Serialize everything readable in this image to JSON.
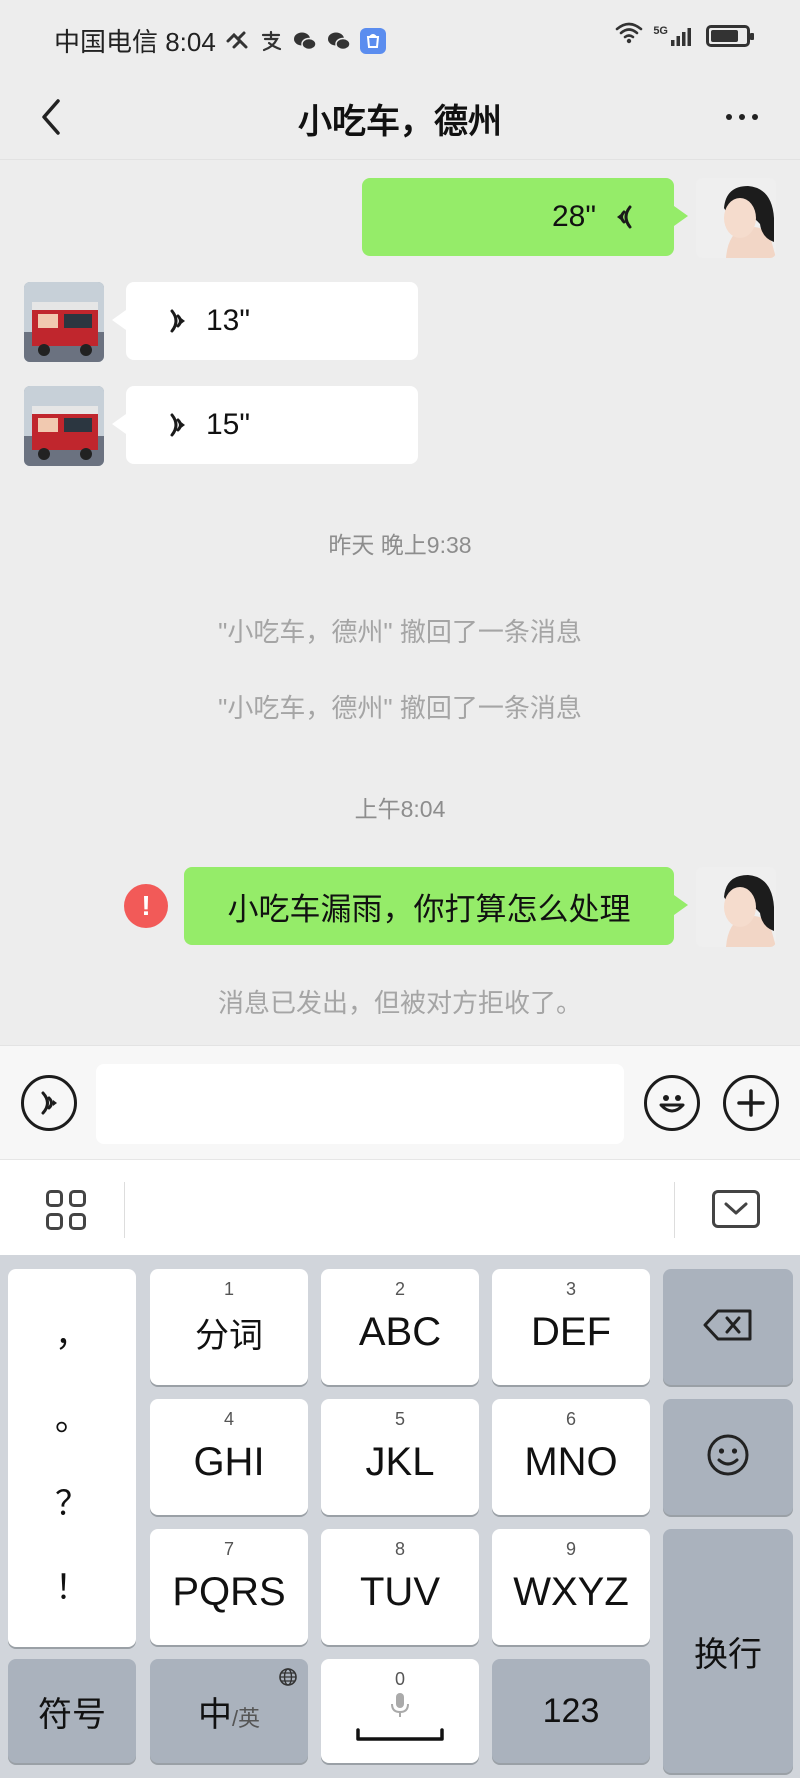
{
  "status_bar": {
    "carrier_time": "中国电信 8:04",
    "icons": [
      "vpn-icon",
      "alipay-icon",
      "wechat-icon",
      "wechat-icon",
      "appstore-icon"
    ],
    "right_icons": [
      "wifi-icon",
      "signal-5g-icon",
      "battery-icon"
    ],
    "network_label": "5G"
  },
  "nav": {
    "title": "小吃车，德州",
    "back_icon": "chevron-left-icon",
    "more_icon": "more-dots-icon"
  },
  "chat": {
    "messages": [
      {
        "sender": "self",
        "type": "voice",
        "duration": "28\""
      },
      {
        "sender": "other",
        "type": "voice",
        "duration": "13\""
      },
      {
        "sender": "other",
        "type": "voice",
        "duration": "15\""
      }
    ],
    "time_yesterday": "昨天 晚上9:38",
    "recall_notes": [
      "\"小吃车，德州\" 撤回了一条消息",
      "\"小吃车，德州\" 撤回了一条消息"
    ],
    "time_today": "上午8:04",
    "text_message": "小吃车漏雨，你打算怎么处理",
    "error_badge": "!",
    "rejected_note": "消息已发出，但被对方拒收了。"
  },
  "input_bar": {
    "voice_icon": "voice-mode-icon",
    "input_value": "",
    "emoji_icon": "emoji-icon",
    "plus_icon": "plus-icon"
  },
  "ime_toolbar": {
    "grid_icon": "apps-grid-icon",
    "collapse_icon": "keyboard-collapse-icon"
  },
  "keyboard": {
    "punctuation": [
      "，",
      "。",
      "？",
      "！"
    ],
    "keys": [
      {
        "num": "1",
        "label": "分词"
      },
      {
        "num": "2",
        "label": "ABC"
      },
      {
        "num": "3",
        "label": "DEF"
      },
      {
        "num": "4",
        "label": "GHI"
      },
      {
        "num": "5",
        "label": "JKL"
      },
      {
        "num": "6",
        "label": "MNO"
      },
      {
        "num": "7",
        "label": "PQRS"
      },
      {
        "num": "8",
        "label": "TUV"
      },
      {
        "num": "9",
        "label": "WXYZ"
      }
    ],
    "backspace_icon": "backspace-icon",
    "emoji_key_icon": "smiley-icon",
    "enter_label": "换行",
    "symbols_label": "符号",
    "lang_main": "中",
    "lang_alt": "/英",
    "globe_icon": "globe-icon",
    "space_num": "0",
    "mic_icon": "mic-icon",
    "numeric_label": "123"
  }
}
